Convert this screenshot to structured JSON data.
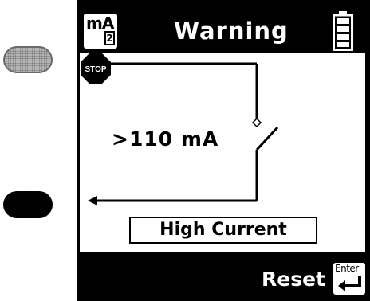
{
  "header": {
    "mode_unit": "mA",
    "mode_sub": "2",
    "title": "Warning",
    "battery_icon": "battery-icon"
  },
  "display": {
    "reading": ">110 mA",
    "status": "High Current",
    "stop_label": "STOP"
  },
  "footer": {
    "action_label": "Reset",
    "enter_key_label": "Enter"
  },
  "colors": {
    "screen_bg": "#000000",
    "panel_bg": "#ffffff",
    "side_button_top": "#b4b4b4",
    "side_button_bottom": "#000000"
  }
}
